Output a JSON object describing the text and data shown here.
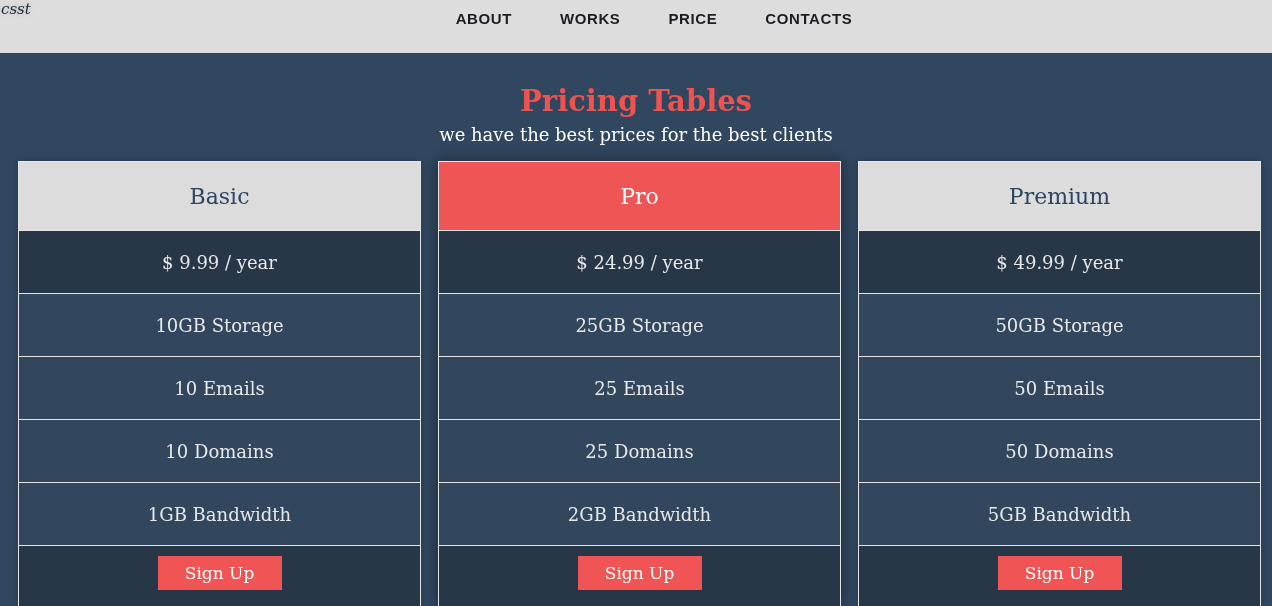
{
  "logo": "csst",
  "nav": [
    "ABOUT",
    "WORKS",
    "PRICE",
    "CONTACTS"
  ],
  "hero": {
    "title": "Pricing Tables",
    "subtitle": "we have the best prices for the best clients"
  },
  "plans": [
    {
      "name": "Basic",
      "featured": false,
      "price": "$ 9.99 / year",
      "features": [
        "10GB Storage",
        "10 Emails",
        "10 Domains",
        "1GB Bandwidth"
      ],
      "button": "Sign Up"
    },
    {
      "name": "Pro",
      "featured": true,
      "price": "$ 24.99 / year",
      "features": [
        "25GB Storage",
        "25 Emails",
        "25 Domains",
        "2GB Bandwidth"
      ],
      "button": "Sign Up"
    },
    {
      "name": "Premium",
      "featured": false,
      "price": "$ 49.99 / year",
      "features": [
        "50GB Storage",
        "50 Emails",
        "50 Domains",
        "5GB Bandwidth"
      ],
      "button": "Sign Up"
    }
  ]
}
